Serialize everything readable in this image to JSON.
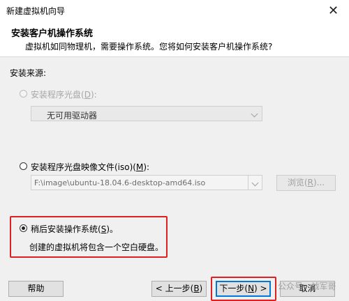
{
  "window": {
    "title": "新建虚拟机向导",
    "close_glyph": "✕"
  },
  "header": {
    "title": "安装客户机操作系统",
    "subtitle": "虚拟机如同物理机，需要操作系统。您将如何安装客户机操作系统?"
  },
  "source": {
    "label": "安装来源:",
    "disc_option": {
      "label_prefix": "安装程序光盘(",
      "hotkey": "D",
      "label_suffix": "):",
      "selected": false,
      "enabled": false
    },
    "drive_select": {
      "value": "无可用驱动器"
    },
    "iso_option": {
      "label_prefix": "安装程序光盘映像文件(iso)(",
      "hotkey": "M",
      "label_suffix": "):",
      "selected": false
    },
    "iso_path": "F:\\image\\ubuntu-18.04.6-desktop-amd64.iso",
    "browse_button": {
      "label_prefix": "浏览(",
      "hotkey": "R",
      "label_suffix": ")..."
    },
    "later_option": {
      "label_prefix": "稍后安装操作系统(",
      "hotkey": "S",
      "label_suffix": ")。",
      "selected": true,
      "description": "创建的虚拟机将包含一个空白硬盘。"
    }
  },
  "footer": {
    "help_label": "帮助",
    "back": {
      "label_prefix": "< 上一步(",
      "hotkey": "B",
      "label_suffix": ")"
    },
    "next": {
      "label_prefix": "下一步(",
      "hotkey": "N",
      "label_suffix": ") >"
    },
    "cancel_label": "取消"
  },
  "watermark": "公众号 · 战军哥",
  "colors": {
    "highlight_box": "#e02020",
    "default_button_border": "#0078d7"
  }
}
